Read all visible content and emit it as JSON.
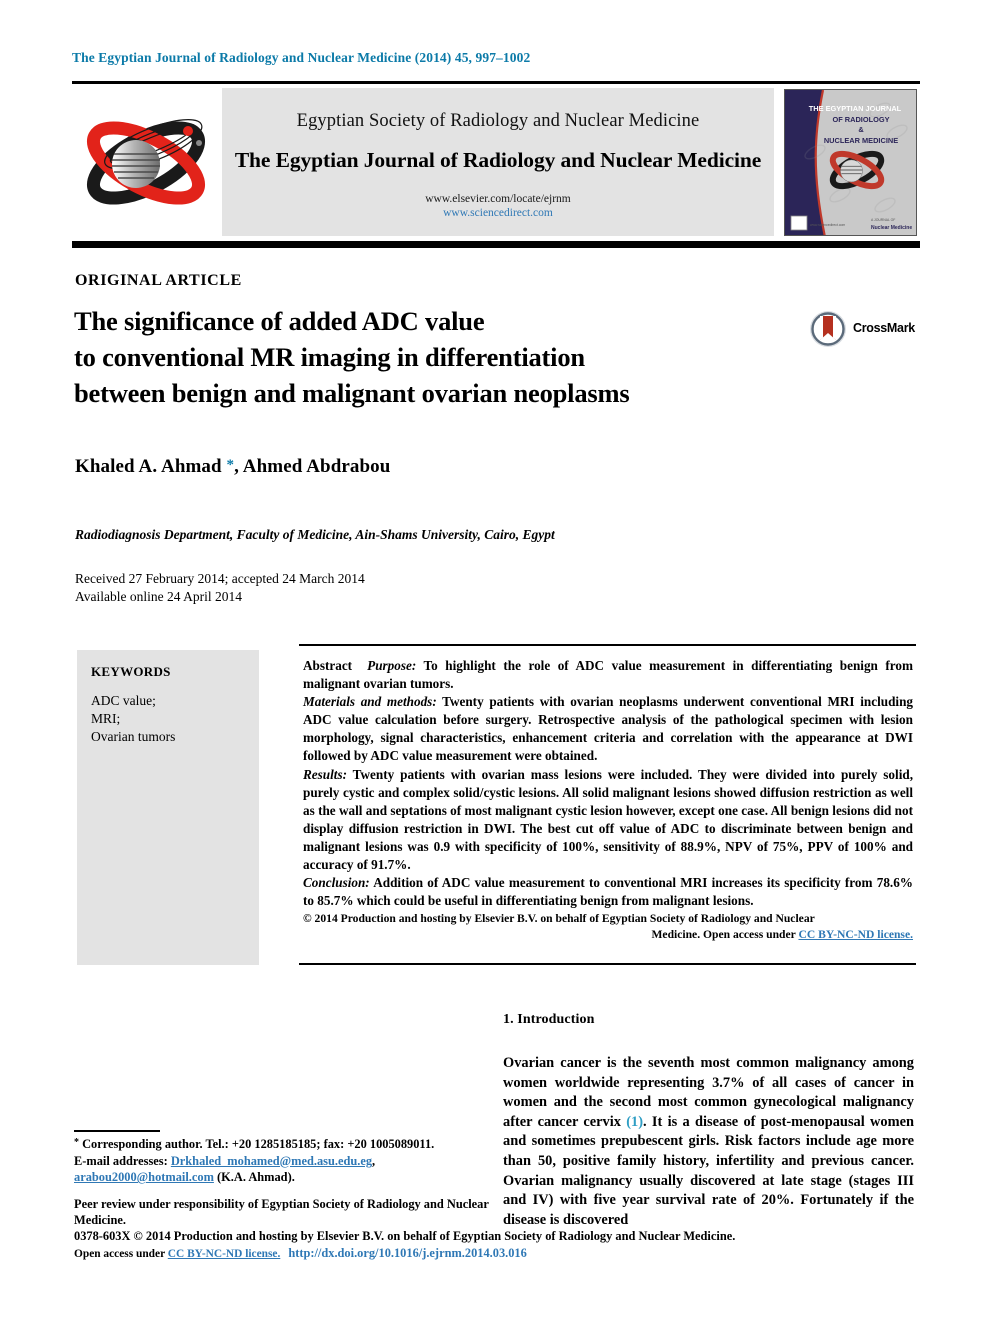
{
  "running_head": "The Egyptian Journal of Radiology and Nuclear Medicine (2014) 45, 997–1002",
  "masthead": {
    "society": "Egyptian Society of Radiology and Nuclear Medicine",
    "journal": "The Egyptian Journal of Radiology and Nuclear Medicine",
    "url_elsevier": "www.elsevier.com/locate/ejrnm",
    "url_sciencedirect": "www.sciencedirect.com",
    "society_logo_icon": "radiology-society-logo-icon",
    "cover_thumb_icon": "journal-cover-thumbnail-icon",
    "cover_title_lines": [
      "THE EGYPTIAN JOURNAL",
      "OF RADIOLOGY",
      "&",
      "NUCLEAR MEDICINE"
    ]
  },
  "article": {
    "type": "ORIGINAL ARTICLE",
    "title_lines": [
      "The significance of added ADC value",
      "to conventional MR imaging in differentiation",
      "between benign and malignant ovarian neoplasms"
    ],
    "crossmark_label": "CrossMark",
    "crossmark_icon": "crossmark-logo-icon",
    "authors": "Khaled A. Ahmad ",
    "authors_star": "*",
    "authors_rest": ", Ahmed Abdrabou",
    "affiliation": "Radiodiagnosis Department, Faculty of Medicine, Ain-Shams University, Cairo, Egypt",
    "received": "Received 27 February 2014; accepted 24 March 2014",
    "available_online": "Available online 24 April 2014"
  },
  "keywords": {
    "heading": "KEYWORDS",
    "items": [
      "ADC value;",
      "MRI;",
      "Ovarian tumors"
    ]
  },
  "abstract": {
    "label": "Abstract",
    "purpose_label": "Purpose:",
    "purpose_text": " To highlight the role of ADC value measurement in differentiating benign from malignant ovarian tumors.",
    "methods_label": "Materials and methods:",
    "methods_text": " Twenty patients with ovarian neoplasms underwent conventional MRI including ADC value calculation before surgery. Retrospective analysis of the pathological specimen with lesion morphology, signal characteristics, enhancement criteria and correlation with the appearance at DWI followed by ADC value measurement were obtained.",
    "results_label": "Results:",
    "results_text": " Twenty patients with ovarian mass lesions were included. They were divided into purely solid, purely cystic and complex solid/cystic lesions. All solid malignant lesions showed diffusion restriction as well as the wall and septations of most malignant cystic lesion however, except one case. All benign lesions did not display diffusion restriction in DWI. The best cut off value of ADC to discriminate between benign and malignant lesions was 0.9 with specificity of 100%, sensitivity of 88.9%, NPV of 75%, PPV of 100% and accuracy of 91.7%.",
    "conclusion_label": "Conclusion:",
    "conclusion_text": " Addition of ADC value measurement to conventional MRI increases its specificity from 78.6% to 85.7% which could be useful in differentiating benign from malignant lesions.",
    "copyright": "© 2014 Production and hosting by Elsevier B.V. on behalf of Egyptian Society of Radiology and Nuclear",
    "copyright_tail": "Medicine. ",
    "open_access_label": "Open access under ",
    "license_link": "CC BY-NC-ND license."
  },
  "introduction": {
    "heading": "1. Introduction",
    "paragraph_pre": "Ovarian cancer is the seventh most common malignancy among women worldwide representing 3.7% of all cases of cancer in women and the second most common gynecological malignancy after cancer cervix ",
    "citation": "(1)",
    "paragraph_post": ". It is a disease of post-menopausal women and sometimes prepubescent girls. Risk factors include age more than 50, positive family history, infertility and previous cancer. Ovarian malignancy usually discovered at late stage (stages III and IV) with five year survival rate of 20%. Fortunately if the disease is discovered"
  },
  "footnote": {
    "corresponding": " Corresponding author. Tel.: +20 1285185185; fax: +20 1005089011.",
    "email_label": "E-mail addresses: ",
    "email1": "Drkhaled_mohamed@med.asu.edu.eg",
    "email_sep": ", ",
    "email2": "arabou2000@hotmail.com",
    "email_owner": " (K.A. Ahmad).",
    "peer_review": "Peer review under responsibility of Egyptian Society of Radiology and Nuclear Medicine."
  },
  "footer": {
    "issn_line": "0378-603X © 2014 Production and hosting by Elsevier B.V. on behalf of Egyptian Society of Radiology and Nuclear Medicine.",
    "open_access_label": "Open access under ",
    "license_link": "CC BY-NC-ND license.",
    "doi": "http://dx.doi.org/10.1016/j.ejrnm.2014.03.016"
  },
  "colors": {
    "running_head": "#0b7aa8",
    "link": "#2f78b5",
    "citation": "#2f9ec4",
    "logo_red": "#e2231a",
    "logo_black": "#1a1a1a",
    "panel_gray": "#e3e3e3",
    "cover_navy": "#2b2558"
  }
}
